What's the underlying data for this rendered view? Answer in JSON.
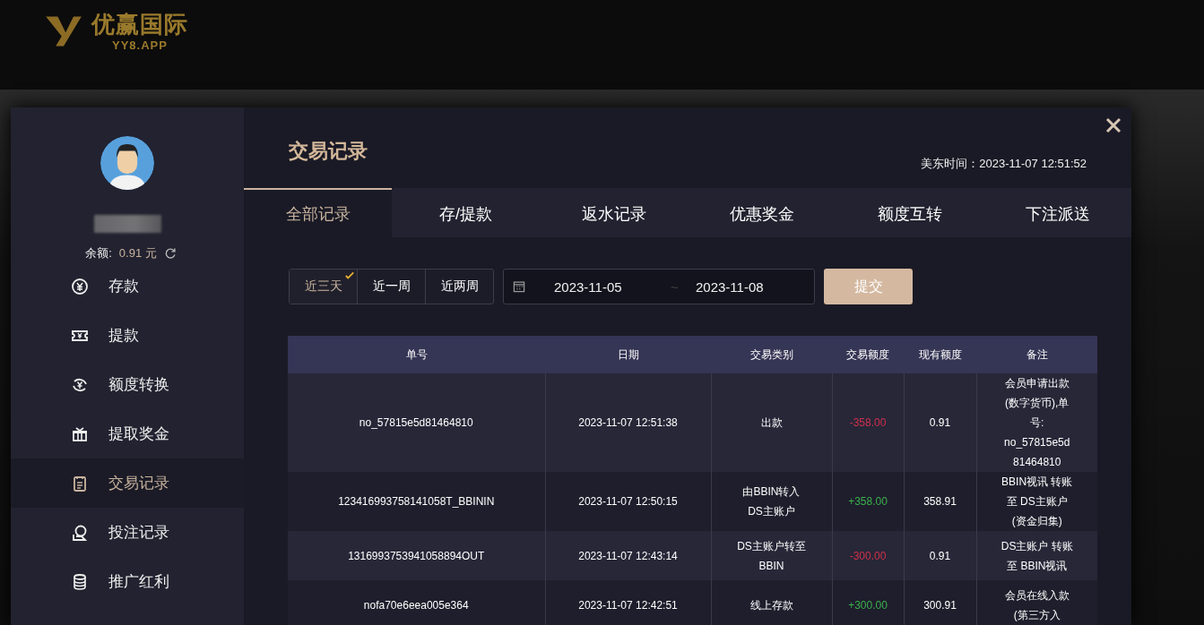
{
  "site_header": {
    "logo_text": "优赢国际",
    "logo_subtext": "YY8.APP"
  },
  "sidebar": {
    "balance_label": "余额:",
    "balance_value": "0.91 元",
    "items": [
      {
        "label": "存款",
        "selected": false
      },
      {
        "label": "提款",
        "selected": false
      },
      {
        "label": "额度转换",
        "selected": false
      },
      {
        "label": "提取奖金",
        "selected": false
      },
      {
        "label": "交易记录",
        "selected": true
      },
      {
        "label": "投注记录",
        "selected": false
      },
      {
        "label": "推广红利",
        "selected": false
      }
    ]
  },
  "panel": {
    "title": "交易记录",
    "time": "美东时间：2023-11-07 12:51:52",
    "tabs": [
      {
        "label": "全部记录",
        "selected": true
      },
      {
        "label": "存/提款",
        "selected": false
      },
      {
        "label": "返水记录",
        "selected": false
      },
      {
        "label": "优惠奖金",
        "selected": false
      },
      {
        "label": "额度互转",
        "selected": false
      },
      {
        "label": "下注派送",
        "selected": false
      }
    ],
    "range_buttons": [
      {
        "label": "近三天",
        "selected": true
      },
      {
        "label": "近一周",
        "selected": false
      },
      {
        "label": "近两周",
        "selected": false
      }
    ],
    "date_start": "2023-11-05",
    "date_separator": "~",
    "date_end": "2023-11-08",
    "submit": "提交"
  },
  "table": {
    "columns": [
      "单号",
      "日期",
      "交易类别",
      "交易额度",
      "现有额度",
      "备注"
    ],
    "rows": [
      {
        "id": "no_57815e5d81464810",
        "date": "2023-11-07 12:51:38",
        "type_lines": [
          "出款"
        ],
        "amount": "-358.00",
        "kind": "debit",
        "balance": "0.91",
        "remark_lines": [
          "会员申请出款",
          "(数字货币),单",
          "号:",
          "no_57815e5d",
          "81464810"
        ]
      },
      {
        "id": "123416993758141058T_BBININ",
        "date": "2023-11-07 12:50:15",
        "type_lines": [
          "由BBIN转入",
          "DS主账户"
        ],
        "amount": "+358.00",
        "kind": "credit",
        "balance": "358.91",
        "remark_lines": [
          "BBIN视讯 转账",
          "至 DS主账户",
          "(资金归集)"
        ]
      },
      {
        "id": "1316993753941058894OUT",
        "date": "2023-11-07 12:43:14",
        "type_lines": [
          "DS主账户转至",
          "BBIN"
        ],
        "amount": "-300.00",
        "kind": "debit",
        "balance": "0.91",
        "remark_lines": [
          "DS主账户 转账",
          "至 BBIN视讯"
        ]
      },
      {
        "id": "nofa70e6eea005e364",
        "date": "2023-11-07 12:42:51",
        "type_lines": [
          "线上存款"
        ],
        "amount": "+300.00",
        "kind": "credit",
        "balance": "300.91",
        "remark_lines": [
          "会员在线入款",
          "(第三方入"
        ]
      }
    ]
  }
}
